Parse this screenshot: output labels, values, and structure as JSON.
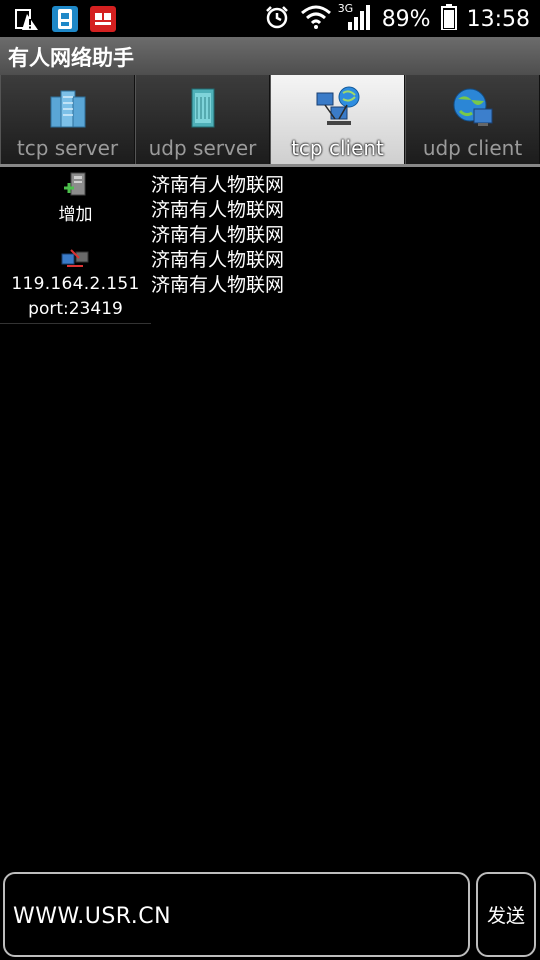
{
  "status_bar": {
    "battery_percent": "89%",
    "time": "13:58",
    "network_type": "3G",
    "icons": [
      "warning-icon",
      "sim-card-icon",
      "red-app-icon",
      "alarm-icon",
      "wifi-icon",
      "signal-icon",
      "battery-icon"
    ]
  },
  "app": {
    "title": "有人网络助手"
  },
  "tabs": [
    {
      "label": "tcp server",
      "icon": "server-rack-icon",
      "active": false
    },
    {
      "label": "udp server",
      "icon": "server-tower-icon",
      "active": false
    },
    {
      "label": "tcp client",
      "icon": "network-computers-icon",
      "active": true
    },
    {
      "label": "udp client",
      "icon": "globe-computer-icon",
      "active": false
    }
  ],
  "connections": {
    "add_label": "增加",
    "items": [
      {
        "ip": "119.164.2.151",
        "port": "port:23419"
      }
    ]
  },
  "messages": [
    "济南有人物联网",
    "济南有人物联网",
    "济南有人物联网",
    "济南有人物联网",
    "济南有人物联网"
  ],
  "composer": {
    "input_value": "WWW.USR.CN",
    "send_label": "发送"
  },
  "colors": {
    "background": "#000000",
    "title_bar": "#5c5c5c",
    "tab_active": "#e6e6e6",
    "tab_inactive": "#2c2c2c",
    "text": "#ffffff"
  }
}
